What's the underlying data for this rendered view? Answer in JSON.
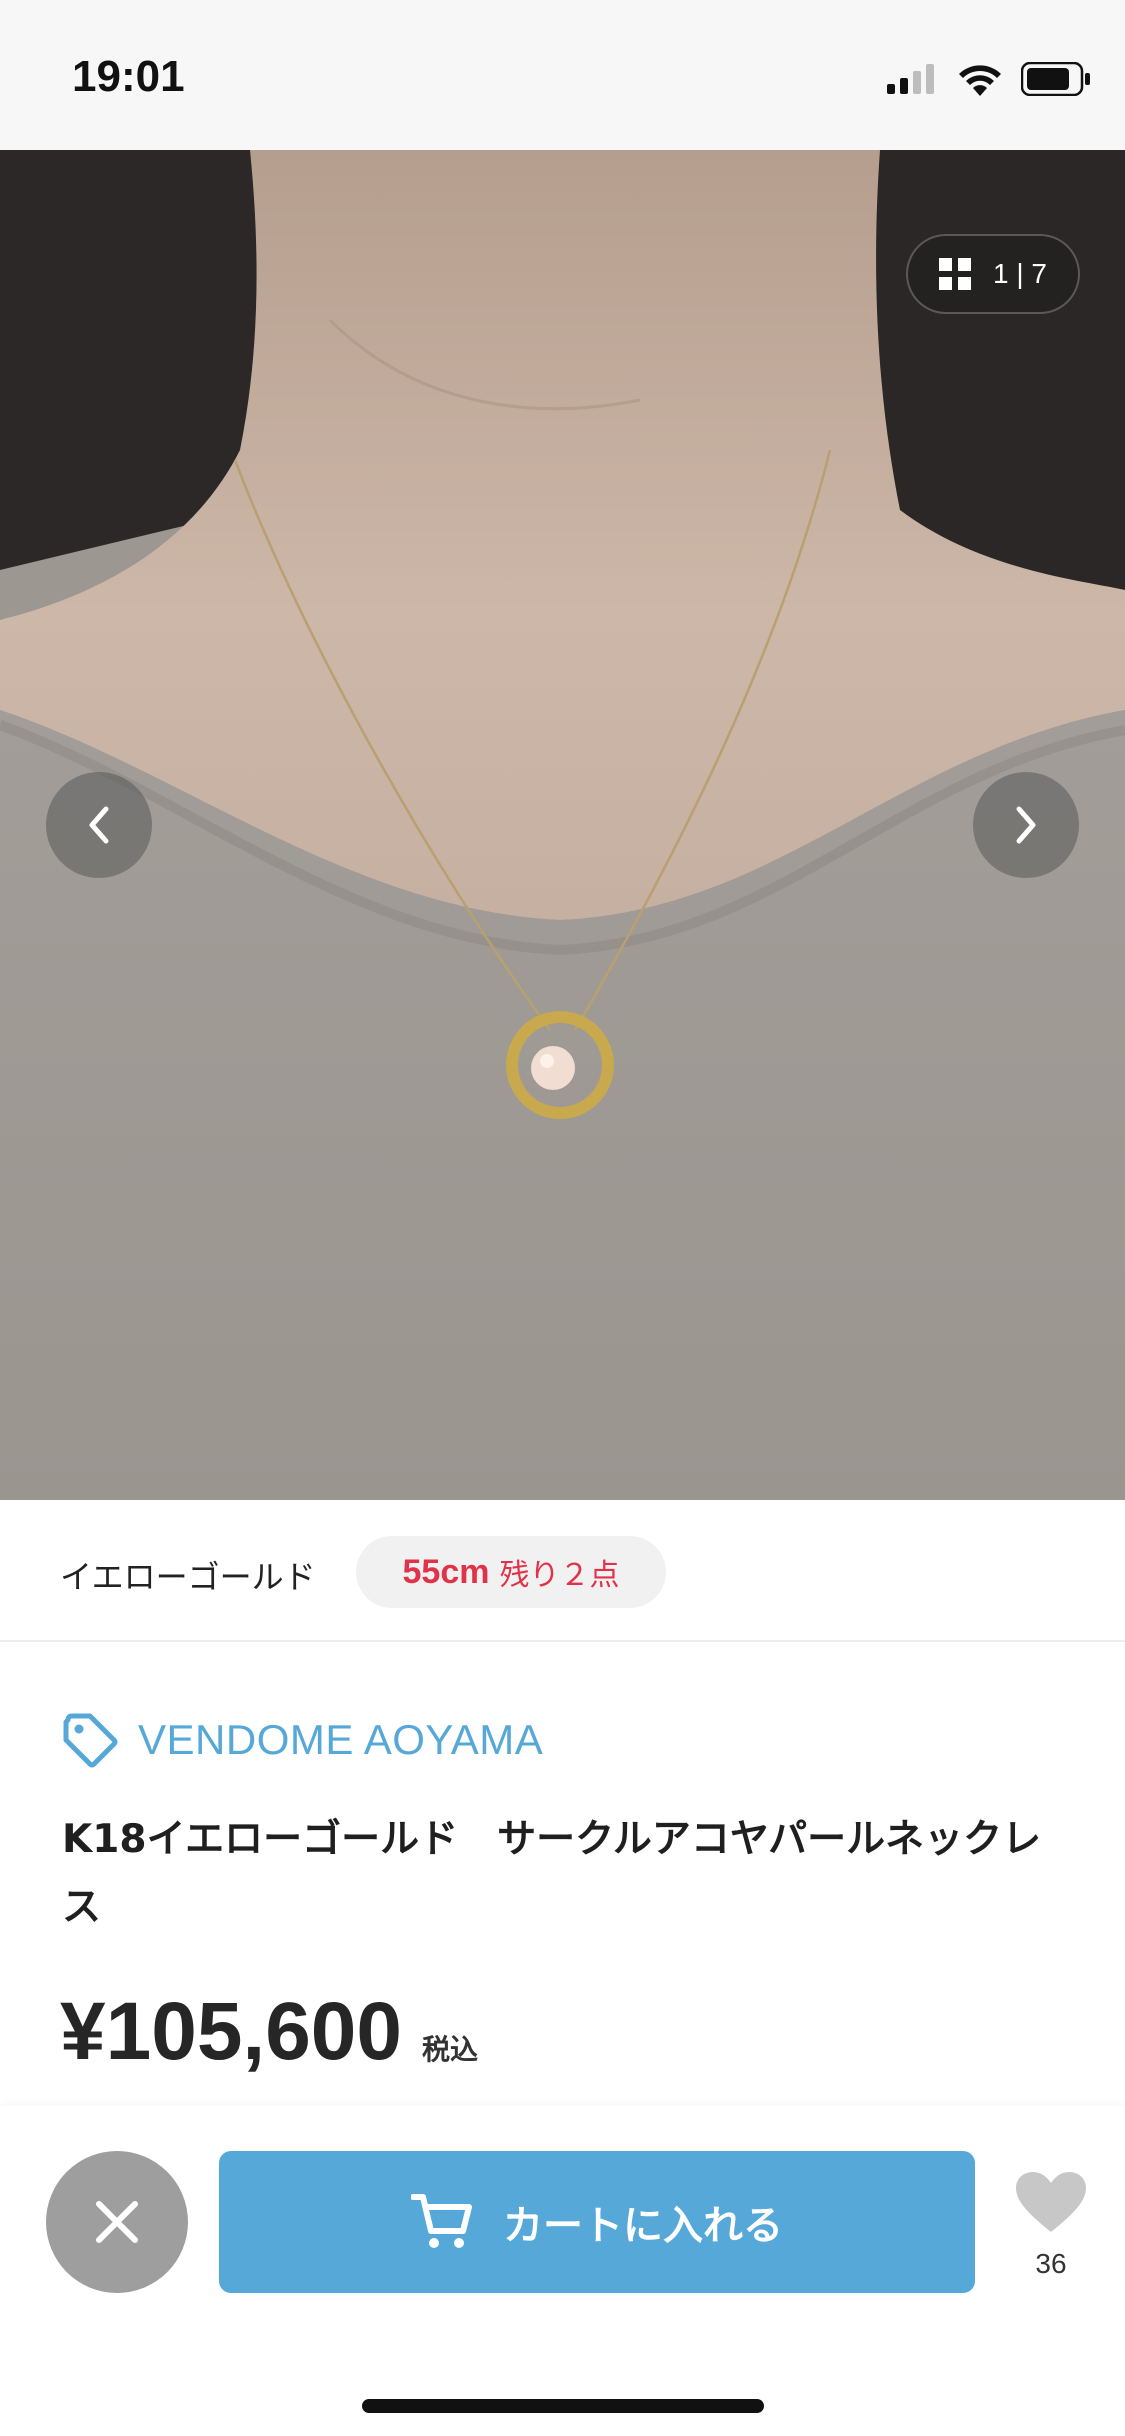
{
  "status_bar": {
    "time": "19:01",
    "icons": [
      "signal-icon",
      "wifi-icon",
      "battery-icon"
    ]
  },
  "gallery": {
    "counter": "1 | 7",
    "icons": [
      "grid-icon",
      "chevron-left-icon",
      "chevron-right-icon"
    ]
  },
  "variant": {
    "color": "イエローゴールド",
    "size": "55cm",
    "stock": "残り２点"
  },
  "product": {
    "brand": "VENDOME AOYAMA",
    "title": "K18イエローゴールド　サークルアコヤパールネックレス",
    "price": "¥105,600",
    "tax": "税込"
  },
  "actions": {
    "cart_label": "カートに入れる",
    "favorite_count": "36"
  },
  "colors": {
    "accent": "#55a8d8",
    "stock_red": "#e0334a",
    "close_gray": "#9e9e9e"
  }
}
